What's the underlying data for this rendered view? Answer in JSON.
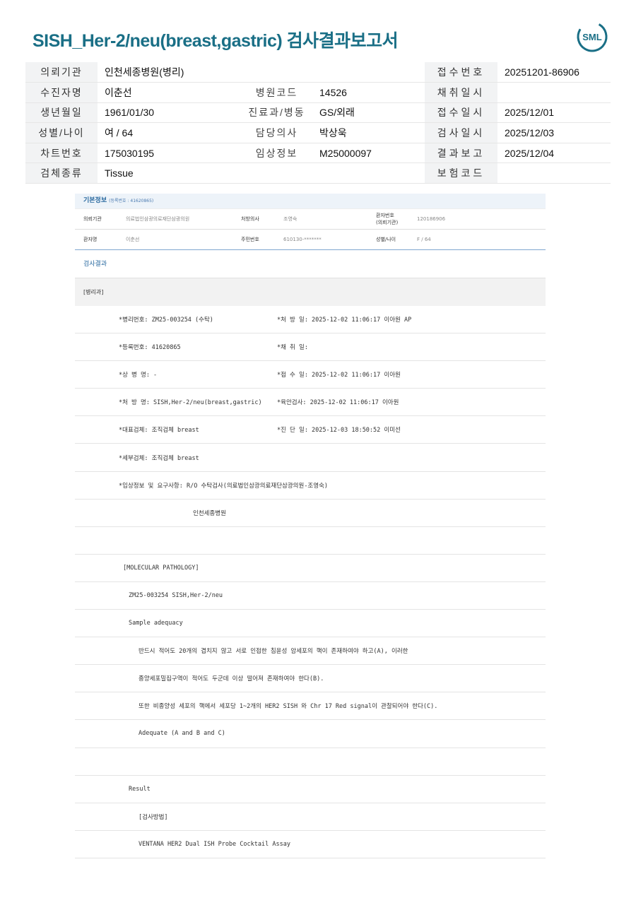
{
  "title": "SISH_Her-2/neu(breast,gastric) 검사결과보고서",
  "logo_text": "SML",
  "colors": {
    "brand": "#1a6f86",
    "section": "#2a6aa0",
    "label_bg": "#f2f3f4"
  },
  "header_rows": [
    {
      "l1": "의뢰기관",
      "v1": "인천세종병원(병리)",
      "l2": "",
      "v2": "",
      "l3": "접수번호",
      "v3": "20251201-86906"
    },
    {
      "l1": "수진자명",
      "v1": "이춘선",
      "l2": "병원코드",
      "v2": "14526",
      "l3": "채취일시",
      "v3": ""
    },
    {
      "l1": "생년월일",
      "v1": "1961/01/30",
      "l2": "진료과/병동",
      "v2": "GS/외래",
      "l3": "접수일시",
      "v3": "2025/12/01"
    },
    {
      "l1": "성별/나이",
      "v1": "여 / 64",
      "l2": "담당의사",
      "v2": "박상욱",
      "l3": "검사일시",
      "v3": "2025/12/03"
    },
    {
      "l1": "차트번호",
      "v1": "175030195",
      "l2": "임상정보",
      "v2": "M25000097",
      "l3": "결과보고",
      "v3": "2025/12/04"
    },
    {
      "l1": "검체종류",
      "v1": "Tissue",
      "l2": "",
      "v2": "",
      "l3": "보험코드",
      "v3": ""
    }
  ],
  "basic": {
    "title": "기본정보",
    "sub": "(등록번호 : 41620865)",
    "row1": [
      "의뢰기관",
      "의료법인삼광의료재단삼광의원",
      "처방의사",
      "조영숙",
      "환자번호\n(의뢰기관)",
      "120186906"
    ],
    "row2": [
      "환자명",
      "이춘선",
      "주민번호",
      "610130-*******",
      "성별/나이",
      "F / 64"
    ]
  },
  "result_title": "검사결과",
  "section_label": "[병리과]",
  "lines": [
    {
      "a": "*병리번호: ZM25-003254 (수탁)",
      "b": "*처 방 일: 2025-12-02 11:06:17  이아원 AP"
    },
    {
      "a": "*등록번호: 41620865",
      "b": "*채 취 일:"
    },
    {
      "a": "*상 병 명: -",
      "b": "*접 수 일: 2025-12-02 11:06:17  이아원"
    },
    {
      "a": "*처 방 명: SISH,Her-2/neu(breast,gastric)",
      "b": "*육안검사: 2025-12-02 11:06:17  이아원"
    },
    {
      "a": "*대표검체: 조직검체 breast",
      "b": "*진 단 일: 2025-12-03 18:50:52  이미선"
    },
    {
      "a": "*세부검체: 조직검체 breast",
      "b": ""
    },
    {
      "a": "*임상정보 및 요구사항: R/O 수탁검사(의료법인삼광의료재단삼광의원-조영숙)",
      "b": ""
    },
    {
      "a": "인천세종병원",
      "b": ""
    },
    {
      "a": "",
      "b": ""
    },
    {
      "a": "[MOLECULAR PATHOLOGY]",
      "b": ""
    },
    {
      "a": "ZM25-003254    SISH,Her-2/neu",
      "b": ""
    },
    {
      "a": "Sample adequacy",
      "b": ""
    },
    {
      "a": "반드시 적어도 20개의 겹치지 않고 서로 인접한 침윤성 암세포의 핵이 존재하여야 하고(A), 이러한",
      "b": ""
    },
    {
      "a": "종양세포밀집구역이 적어도 두군데 이상 떨어져 존재하여야 한다(B).",
      "b": ""
    },
    {
      "a": "또한 비종양성 세포의 핵에서 세포당 1~2개의 HER2 SISH 와 Chr 17 Red signal이 관찰되어야 한다(C).",
      "b": ""
    },
    {
      "a": "Adequate (A and B and C)",
      "b": ""
    },
    {
      "a": "",
      "b": ""
    },
    {
      "a": "Result",
      "b": ""
    },
    {
      "a": "[검사방법]",
      "b": ""
    },
    {
      "a": "VENTANA HER2 Dual ISH Probe Cocktail Assay",
      "b": ""
    }
  ]
}
